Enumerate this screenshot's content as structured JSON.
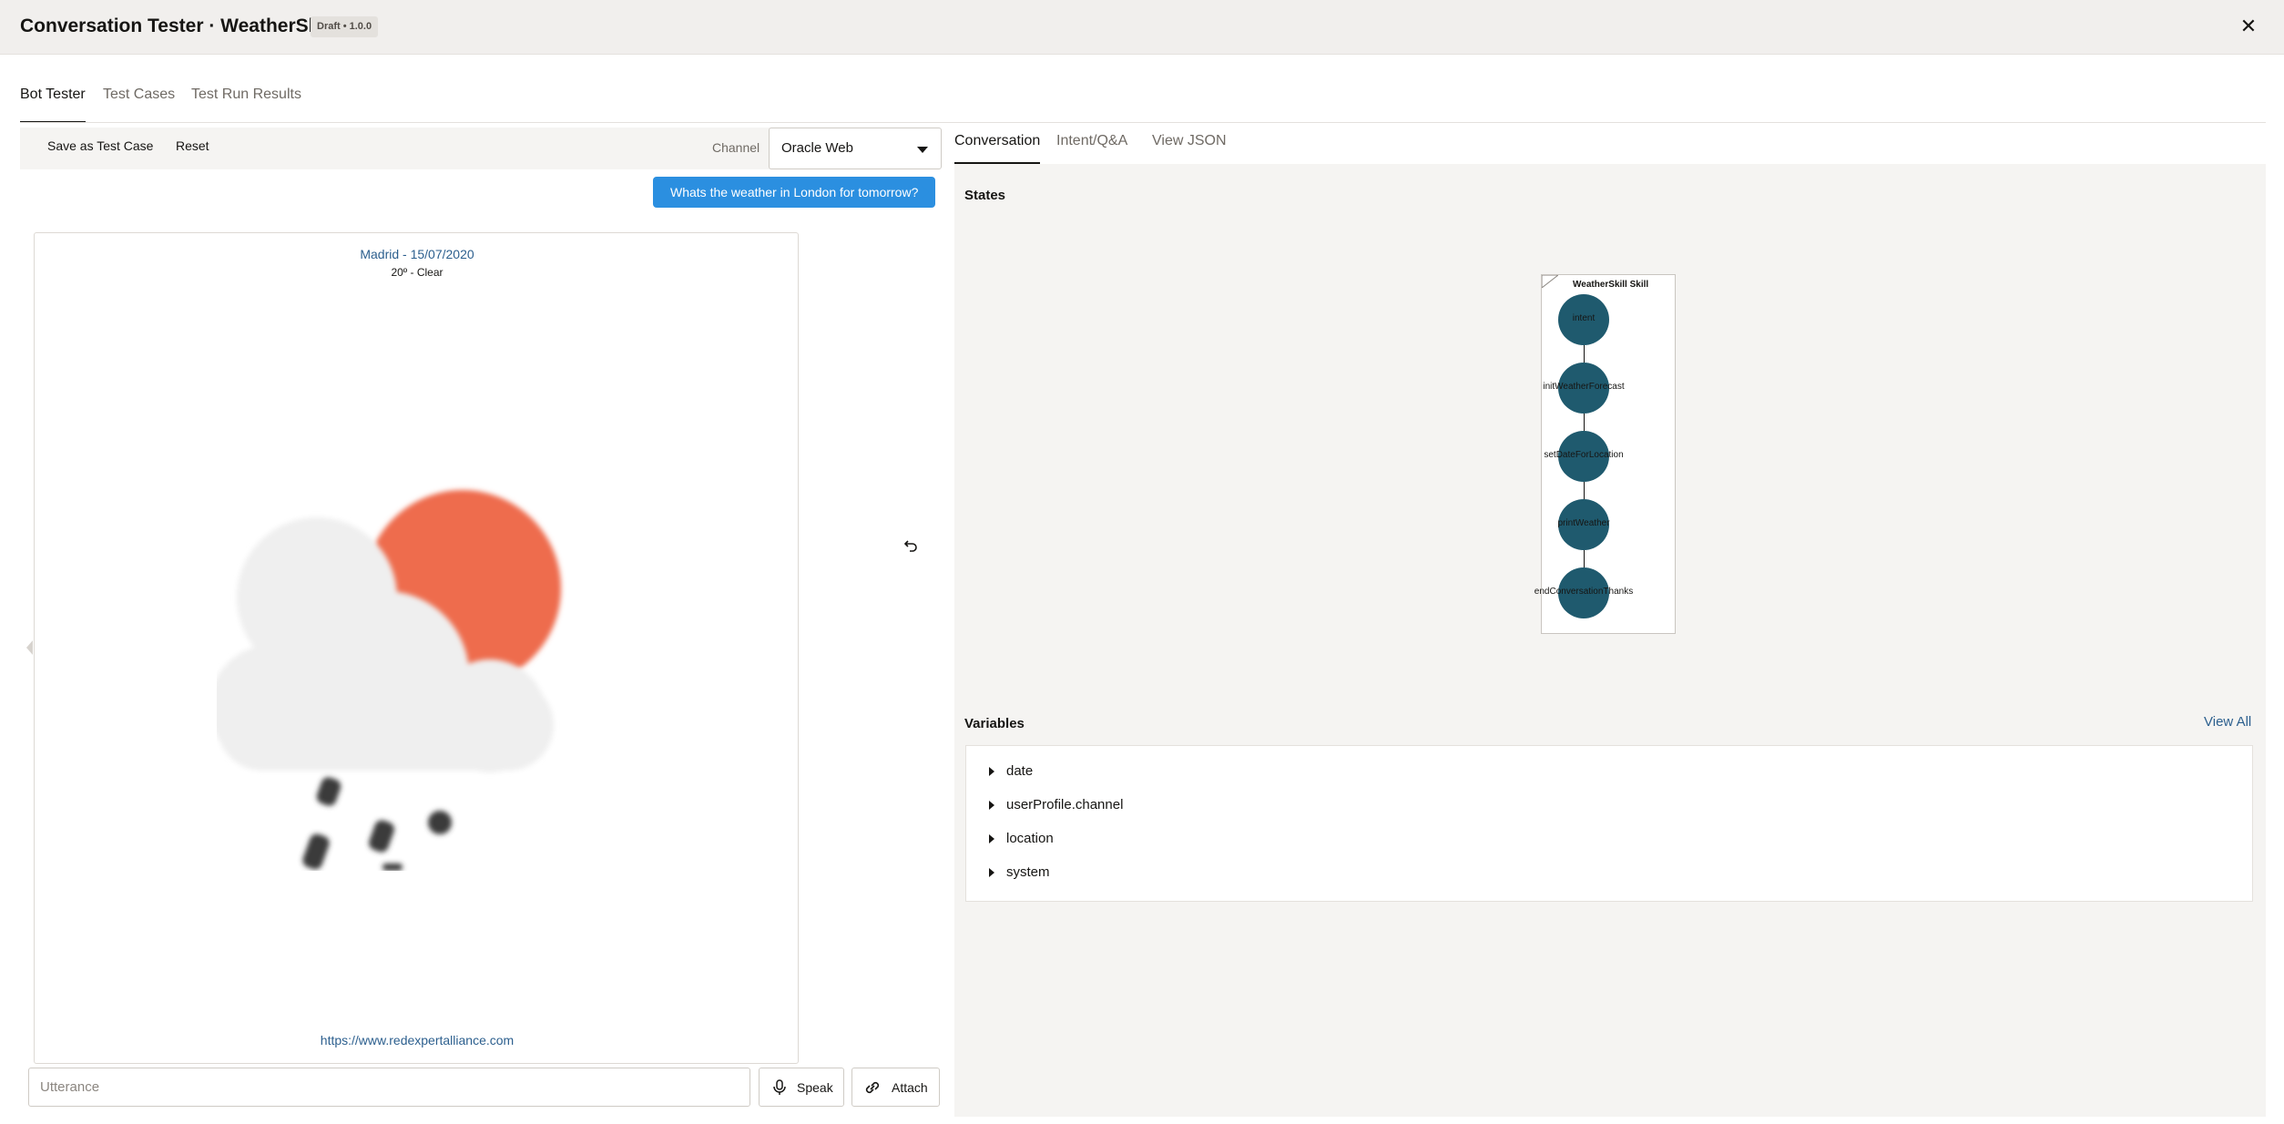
{
  "header": {
    "title": "Conversation Tester · WeatherSkill",
    "badge": "Draft • 1.0.0",
    "close_icon": "close-icon"
  },
  "tabs": [
    {
      "label": "Bot Tester",
      "active": true
    },
    {
      "label": "Test Cases",
      "active": false
    },
    {
      "label": "Test Run Results",
      "active": false
    }
  ],
  "toolbar": {
    "save_label": "Save as Test Case",
    "reset_label": "Reset",
    "channel_label": "Channel",
    "channel_value": "Oracle Web"
  },
  "chat": {
    "user_message": "Whats the weather in London for tomorrow?",
    "card": {
      "title": "Madrid - 15/07/2020",
      "subtitle": "20º - Clear",
      "image_icon": "weather-cloud-sun-rain-icon",
      "link": "https://www.redexpertalliance.com"
    }
  },
  "input": {
    "placeholder": "Utterance",
    "speak_label": "Speak",
    "attach_label": "Attach"
  },
  "right_tabs": [
    {
      "label": "Conversation",
      "active": true
    },
    {
      "label": "Intent/Q&A",
      "active": false
    },
    {
      "label": "View JSON",
      "active": false
    }
  ],
  "states": {
    "title": "States",
    "graph_label": "WeatherSkill Skill",
    "nodes": [
      "intent",
      "initWeatherForecast",
      "setDateForLocation",
      "printWeather",
      "endConversationThanks"
    ]
  },
  "variables": {
    "title": "Variables",
    "view_all": "View All",
    "items": [
      "date",
      "userProfile.channel",
      "location",
      "system"
    ]
  },
  "colors": {
    "accent": "#2b8fe0",
    "node": "#1f5a6e",
    "link": "#2c5f8e"
  }
}
